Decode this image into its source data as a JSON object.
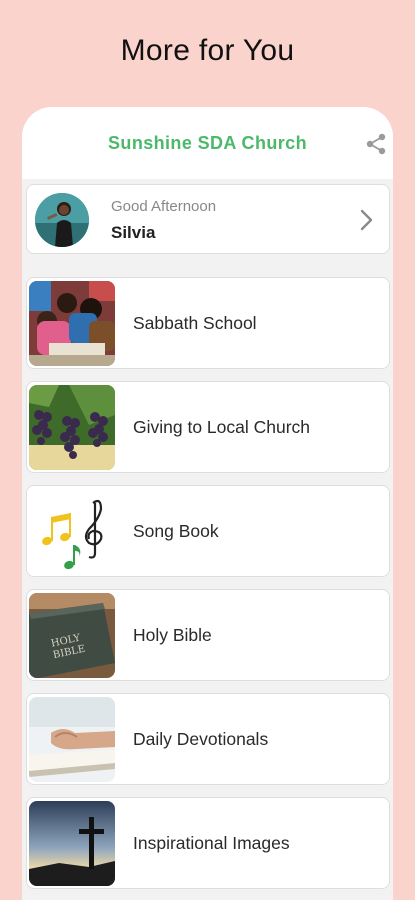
{
  "promo": {
    "title": "More for You"
  },
  "header": {
    "title": "Sunshine SDA Church",
    "share_icon": "share-icon"
  },
  "greeting": {
    "text": "Good Afternoon",
    "name": "Silvia"
  },
  "menu": [
    {
      "label": "Sabbath School",
      "icon": "children-reading-photo"
    },
    {
      "label": "Giving to Local Church",
      "icon": "grapes-vine-photo"
    },
    {
      "label": "Song Book",
      "icon": "music-notes-icon"
    },
    {
      "label": "Holy Bible",
      "icon": "bible-photo"
    },
    {
      "label": "Daily Devotionals",
      "icon": "praying-hands-photo"
    },
    {
      "label": "Inspirational Images",
      "icon": "cross-sunset-photo"
    }
  ],
  "colors": {
    "background": "#fbd3cd",
    "accent": "#4cb86a"
  }
}
